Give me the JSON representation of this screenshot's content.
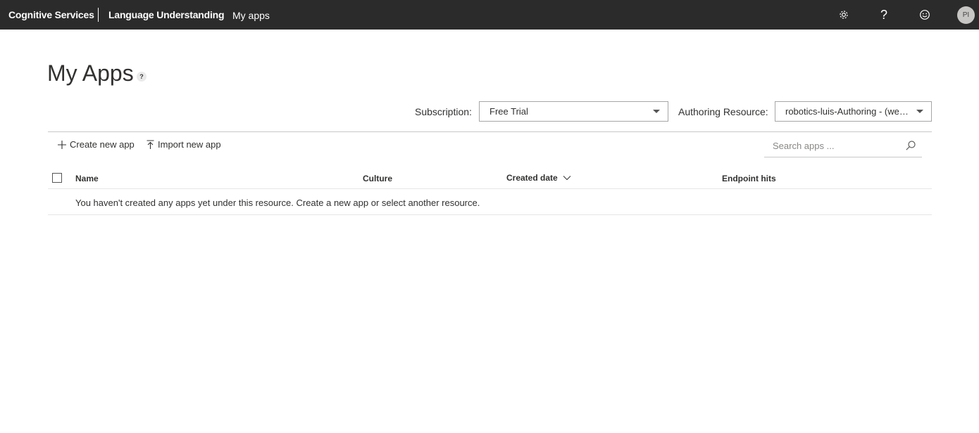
{
  "topbar": {
    "brand": "Cognitive Services",
    "product": "Language Understanding",
    "breadcrumb": "My apps",
    "help_glyph": "?",
    "avatar_initials": "PI"
  },
  "page": {
    "title": "My Apps",
    "title_help_glyph": "?"
  },
  "selectors": {
    "subscription_label": "Subscription:",
    "subscription_value": "Free Trial",
    "resource_label": "Authoring Resource:",
    "resource_value": "robotics-luis-Authoring - (westus)"
  },
  "commands": {
    "create_label": "Create new app",
    "import_label": "Import new app"
  },
  "search": {
    "placeholder": "Search apps ..."
  },
  "table": {
    "columns": [
      "Name",
      "Culture",
      "Created date",
      "Endpoint hits"
    ],
    "sorted_column": "Created date",
    "empty_message": "You haven't created any apps yet under this resource. Create a new app or select another resource."
  },
  "icons": {
    "settings": "gear-icon",
    "help": "help-icon",
    "feedback": "smiley-icon",
    "create": "plus-icon",
    "import": "upload-icon",
    "search": "search-icon",
    "sort": "chevron-down-icon"
  }
}
